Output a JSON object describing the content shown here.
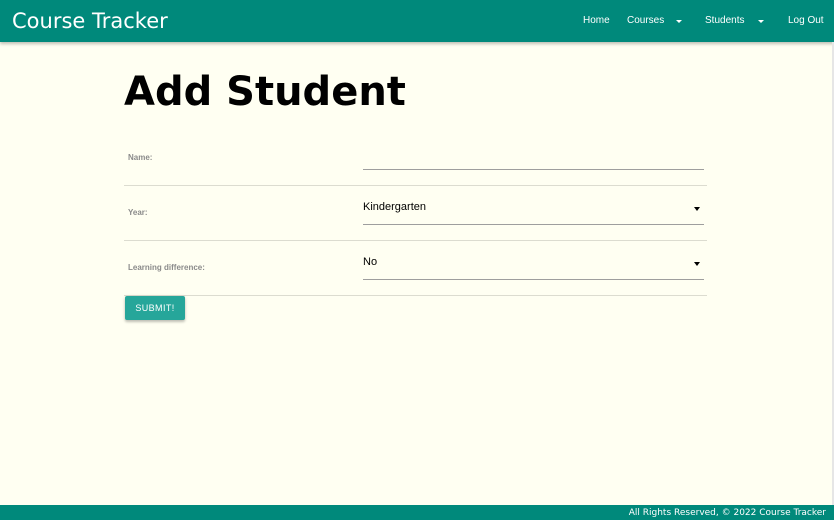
{
  "navbar": {
    "brand": "Course Tracker",
    "home_label": "Home",
    "courses_label": "Courses",
    "students_label": "Students",
    "logout_label": "Log Out"
  },
  "page": {
    "title": "Add Student"
  },
  "form": {
    "name_label": "Name:",
    "name_value": "",
    "year_label": "Year:",
    "year_value": "Kindergarten",
    "learning_label": "Learning difference:",
    "learning_value": "No",
    "submit_label": "SUBMIT!"
  },
  "footer": {
    "text": "All Rights Reserved, © 2022 Course Tracker"
  },
  "colors": {
    "navbar": "#00897b",
    "background": "#fffff2",
    "button": "#26a69a"
  },
  "icons": [
    "dropdown-caret-icon"
  ]
}
